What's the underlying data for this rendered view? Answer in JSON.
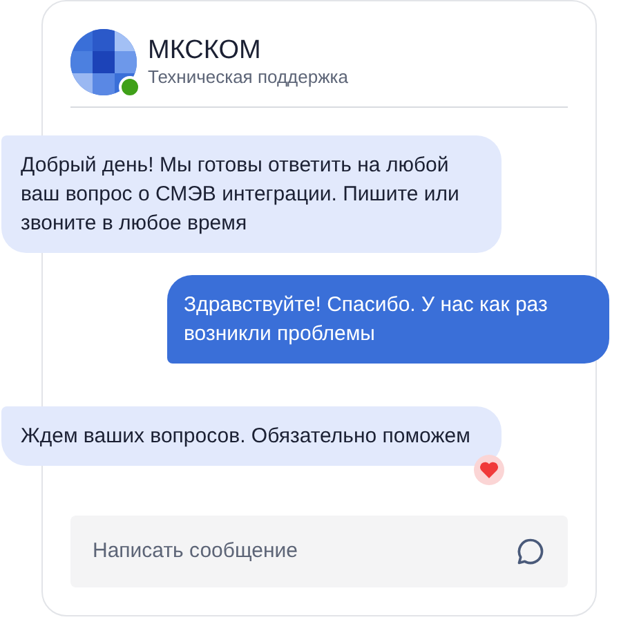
{
  "header": {
    "title": "МКСКОМ",
    "subtitle": "Техническая поддержка",
    "online": true
  },
  "messages": [
    {
      "kind": "incoming",
      "text": "Добрый день! Мы готовы ответить на любой ваш вопрос о СМЭВ интеграции. Пишите или звоните в любое время",
      "liked": false
    },
    {
      "kind": "outgoing",
      "text": "Здравствуйте! Спасибо. У нас как раз возникли проблемы",
      "liked": false
    },
    {
      "kind": "incoming",
      "text": "Ждем ваших вопросов. Обязательно поможем",
      "liked": true
    }
  ],
  "composer": {
    "placeholder": "Написать сообщение"
  }
}
